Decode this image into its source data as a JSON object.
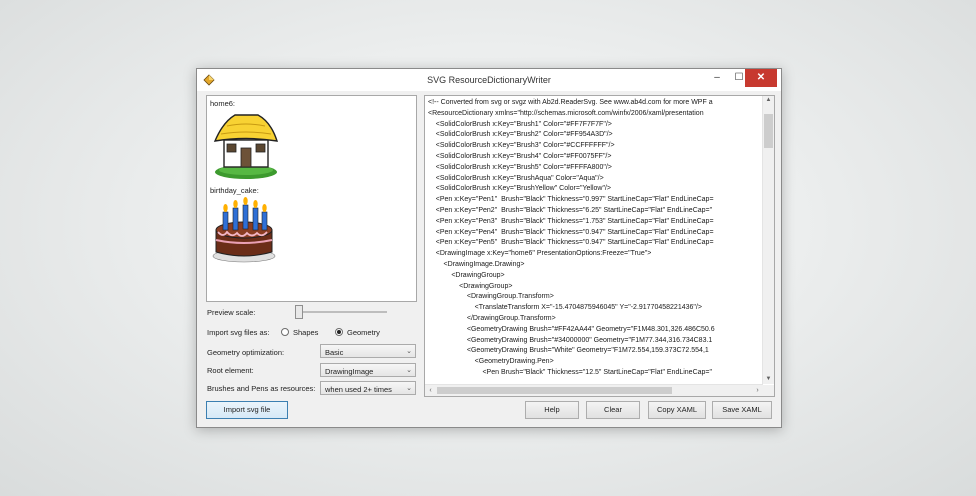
{
  "window": {
    "title": "SVG ResourceDictionaryWriter",
    "minimize_glyph": "–",
    "maximize_glyph": "☐",
    "close_glyph": "✕"
  },
  "preview": {
    "items": [
      {
        "label": "home6:",
        "icon": "house-icon"
      },
      {
        "label": "birthday_cake:",
        "icon": "cake-icon"
      }
    ]
  },
  "options": {
    "preview_scale_label": "Preview scale:",
    "preview_scale_value": 0.15,
    "import_as_label": "Import svg files as:",
    "shapes_label": "Shapes",
    "geometry_label": "Geometry",
    "import_as_selected": "Geometry",
    "geometry_optimization_label": "Geometry optimization:",
    "geometry_optimization_value": "Basic",
    "root_element_label": "Root element:",
    "root_element_value": "DrawingImage",
    "brushes_pens_label": "Brushes and Pens as resources:",
    "brushes_pens_value": "when used 2+ times"
  },
  "buttons": {
    "import": "Import svg file",
    "help": "Help",
    "clear": "Clear",
    "copy": "Copy XAML",
    "save": "Save XAML"
  },
  "xaml_lines": [
    "<!-- Converted from svg or svgz with Ab2d.ReaderSvg. See www.ab4d.com for more WPF a",
    "<ResourceDictionary xmlns=\"http://schemas.microsoft.com/winfx/2006/xaml/presentation",
    "    <SolidColorBrush x:Key=\"Brush1\" Color=\"#FF7F7F7F\"/>",
    "    <SolidColorBrush x:Key=\"Brush2\" Color=\"#FF954A3D\"/>",
    "    <SolidColorBrush x:Key=\"Brush3\" Color=\"#CCFFFFFF\"/>",
    "    <SolidColorBrush x:Key=\"Brush4\" Color=\"#FF0075FF\"/>",
    "    <SolidColorBrush x:Key=\"Brush5\" Color=\"#FFFFA800\"/>",
    "    <SolidColorBrush x:Key=\"BrushAqua\" Color=\"Aqua\"/>",
    "    <SolidColorBrush x:Key=\"BrushYellow\" Color=\"Yellow\"/>",
    "    <Pen x:Key=\"Pen1\"  Brush=\"Black\" Thickness=\"0.997\" StartLineCap=\"Flat\" EndLineCap=",
    "    <Pen x:Key=\"Pen2\"  Brush=\"Black\" Thickness=\"6.25\" StartLineCap=\"Flat\" EndLineCap=\"",
    "    <Pen x:Key=\"Pen3\"  Brush=\"Black\" Thickness=\"1.753\" StartLineCap=\"Flat\" EndLineCap=",
    "    <Pen x:Key=\"Pen4\"  Brush=\"Black\" Thickness=\"0.947\" StartLineCap=\"Flat\" EndLineCap=",
    "    <Pen x:Key=\"Pen5\"  Brush=\"Black\" Thickness=\"0.947\" StartLineCap=\"Flat\" EndLineCap=",
    "    <DrawingImage x:Key=\"home6\" PresentationOptions:Freeze=\"True\">",
    "        <DrawingImage.Drawing>",
    "            <DrawingGroup>",
    "                <DrawingGroup>",
    "                    <DrawingGroup.Transform>",
    "                        <TranslateTransform X=\"-15.4704875946045\" Y=\"-2.91770458221436\"/>",
    "                    </DrawingGroup.Transform>",
    "                    <GeometryDrawing Brush=\"#FF42AA44\" Geometry=\"F1M48.301,326.486C50.6",
    "                    <GeometryDrawing Brush=\"#34000000\" Geometry=\"F1M77.344,316.734C83.1",
    "                    <GeometryDrawing Brush=\"White\" Geometry=\"F1M72.554,159.373C72.554,1",
    "                        <GeometryDrawing.Pen>",
    "                            <Pen Brush=\"Black\" Thickness=\"12.5\" StartLineCap=\"Flat\" EndLineCap=\""
  ]
}
